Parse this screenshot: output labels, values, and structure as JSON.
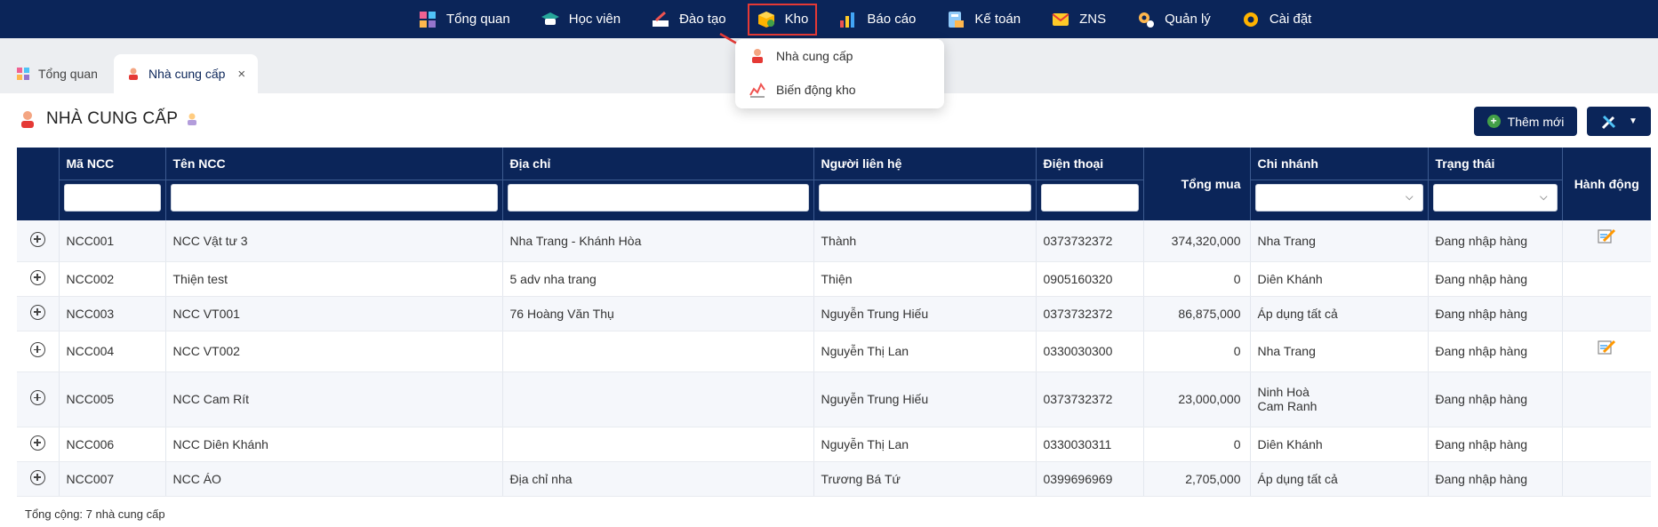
{
  "nav": {
    "items": [
      {
        "label": "Tổng quan",
        "icon": "dashboard-icon"
      },
      {
        "label": "Học viên",
        "icon": "student-icon"
      },
      {
        "label": "Đào tạo",
        "icon": "training-icon"
      },
      {
        "label": "Kho",
        "icon": "warehouse-icon"
      },
      {
        "label": "Báo cáo",
        "icon": "report-icon"
      },
      {
        "label": "Kế toán",
        "icon": "accounting-icon"
      },
      {
        "label": "ZNS",
        "icon": "zns-icon"
      },
      {
        "label": "Quản lý",
        "icon": "management-icon"
      },
      {
        "label": "Cài đặt",
        "icon": "settings-icon"
      }
    ]
  },
  "dropdown": {
    "items": [
      {
        "label": "Nhà cung cấp",
        "icon": "supplier-icon"
      },
      {
        "label": "Biến động kho",
        "icon": "stock-chart-icon"
      }
    ]
  },
  "tabs": [
    {
      "label": "Tổng quan",
      "icon": "dashboard-icon"
    },
    {
      "label": "Nhà cung cấp",
      "icon": "supplier-icon",
      "close": "×"
    }
  ],
  "page": {
    "title": "NHÀ CUNG CẤP",
    "add_button": "Thêm mới",
    "footer_total": "Tổng cộng: 7 nhà cung cấp"
  },
  "table": {
    "headers": {
      "code": "Mã NCC",
      "name": "Tên NCC",
      "address": "Địa chỉ",
      "contact": "Người liên hệ",
      "phone": "Điện thoại",
      "total": "Tổng mua",
      "branch": "Chi nhánh",
      "status": "Trạng thái",
      "action": "Hành động"
    },
    "rows": [
      {
        "code": "NCC001",
        "name": "NCC Vật tư 3",
        "address": "Nha Trang - Khánh Hòa",
        "contact": "Thành",
        "phone": "0373732372",
        "total": "374,320,000",
        "branch1": "Nha Trang",
        "branch2": "",
        "status": "Đang nhập hàng",
        "edit": true
      },
      {
        "code": "NCC002",
        "name": "Thiện test",
        "address": "5 adv nha trang",
        "contact": "Thiện",
        "phone": "0905160320",
        "total": "0",
        "branch1": "Diên Khánh",
        "branch2": "",
        "status": "Đang nhập hàng",
        "edit": false
      },
      {
        "code": "NCC003",
        "name": "NCC VT001",
        "address": "76 Hoàng Văn Thụ",
        "contact": "Nguyễn Trung Hiếu",
        "phone": "0373732372",
        "total": "86,875,000",
        "branch1": "Áp dụng tất cả",
        "branch2": "",
        "status": "Đang nhập hàng",
        "edit": false
      },
      {
        "code": "NCC004",
        "name": "NCC VT002",
        "address": "",
        "contact": "Nguyễn Thị Lan",
        "phone": "0330030300",
        "total": "0",
        "branch1": "Nha Trang",
        "branch2": "",
        "status": "Đang nhập hàng",
        "edit": true
      },
      {
        "code": "NCC005",
        "name": "NCC Cam Rít",
        "address": "",
        "contact": "Nguyễn Trung Hiếu",
        "phone": "0373732372",
        "total": "23,000,000",
        "branch1": "Ninh Hoà",
        "branch2": "Cam Ranh",
        "status": "Đang nhập hàng",
        "edit": false
      },
      {
        "code": "NCC006",
        "name": "NCC Diên Khánh",
        "address": "",
        "contact": "Nguyễn Thị Lan",
        "phone": "0330030311",
        "total": "0",
        "branch1": "Diên Khánh",
        "branch2": "",
        "status": "Đang nhập hàng",
        "edit": false
      },
      {
        "code": "NCC007",
        "name": "NCC ÁO",
        "address": "Địa chỉ nha",
        "contact": "Trương Bá Tứ",
        "phone": "0399696969",
        "total": "2,705,000",
        "branch1": "Áp dụng tất cả",
        "branch2": "",
        "status": "Đang nhập hàng",
        "edit": false
      }
    ]
  },
  "colors": {
    "navy": "#0b2559",
    "highlight": "#e53935",
    "add_green": "#43a047"
  }
}
